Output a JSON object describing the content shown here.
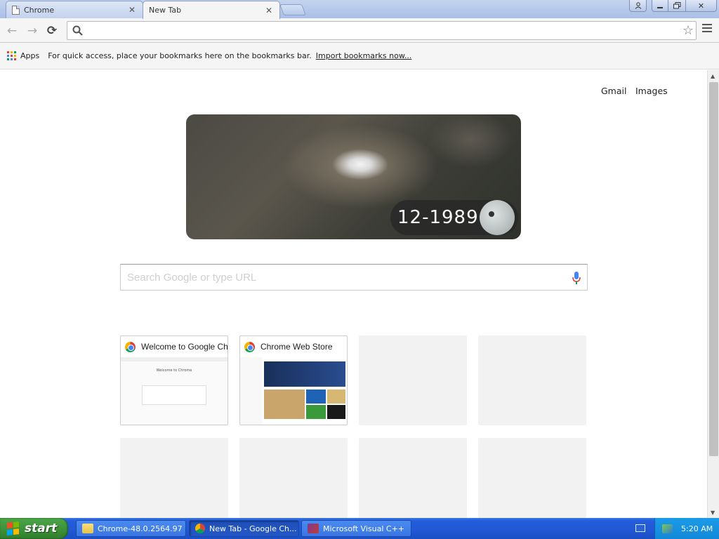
{
  "tabs": [
    {
      "label": "Chrome",
      "icon": "page-icon",
      "active": false
    },
    {
      "label": "New Tab",
      "icon": "page-icon",
      "active": true
    }
  ],
  "window_controls": {
    "user": "person-icon",
    "minimize": "minimize-icon",
    "maximize": "restore-icon",
    "close": "close-icon"
  },
  "toolbar": {
    "omnibox_value": "",
    "star_icon": "star-icon",
    "menu_icon": "hamburger-menu-icon"
  },
  "bookmarks": {
    "apps_label": "Apps",
    "hint": "For quick access, place your bookmarks here on the bookmarks bar.",
    "import_link": "Import bookmarks now..."
  },
  "page": {
    "gmail": "Gmail",
    "images": "Images",
    "doodle_date": "12-1989",
    "search_placeholder": "Search Google or type URL"
  },
  "tiles": [
    {
      "title": "Welcome to Google Chrome",
      "icon": "chrome-icon",
      "thumb_heading": "Welcome to Chrome",
      "filled": true
    },
    {
      "title": "Chrome Web Store",
      "icon": "chrome-icon",
      "filled": true
    },
    {
      "title": "",
      "filled": false
    },
    {
      "title": "",
      "filled": false
    },
    {
      "title": "",
      "filled": false
    },
    {
      "title": "",
      "filled": false
    },
    {
      "title": "",
      "filled": false
    },
    {
      "title": "",
      "filled": false
    }
  ],
  "taskbar": {
    "start_label": "start",
    "tasks": [
      {
        "label": "Chrome-48.0.2564.97",
        "icon": "folder-icon"
      },
      {
        "label": "New Tab - Google Ch...",
        "icon": "chrome-icon",
        "active": true
      },
      {
        "label": "Microsoft Visual C++",
        "icon": "visual-cpp-icon"
      }
    ],
    "clock": "5:20 AM"
  },
  "colors": {
    "taskbar_blue": "#245edb",
    "start_green": "#3a8f37",
    "tray_blue": "#1288d8"
  }
}
